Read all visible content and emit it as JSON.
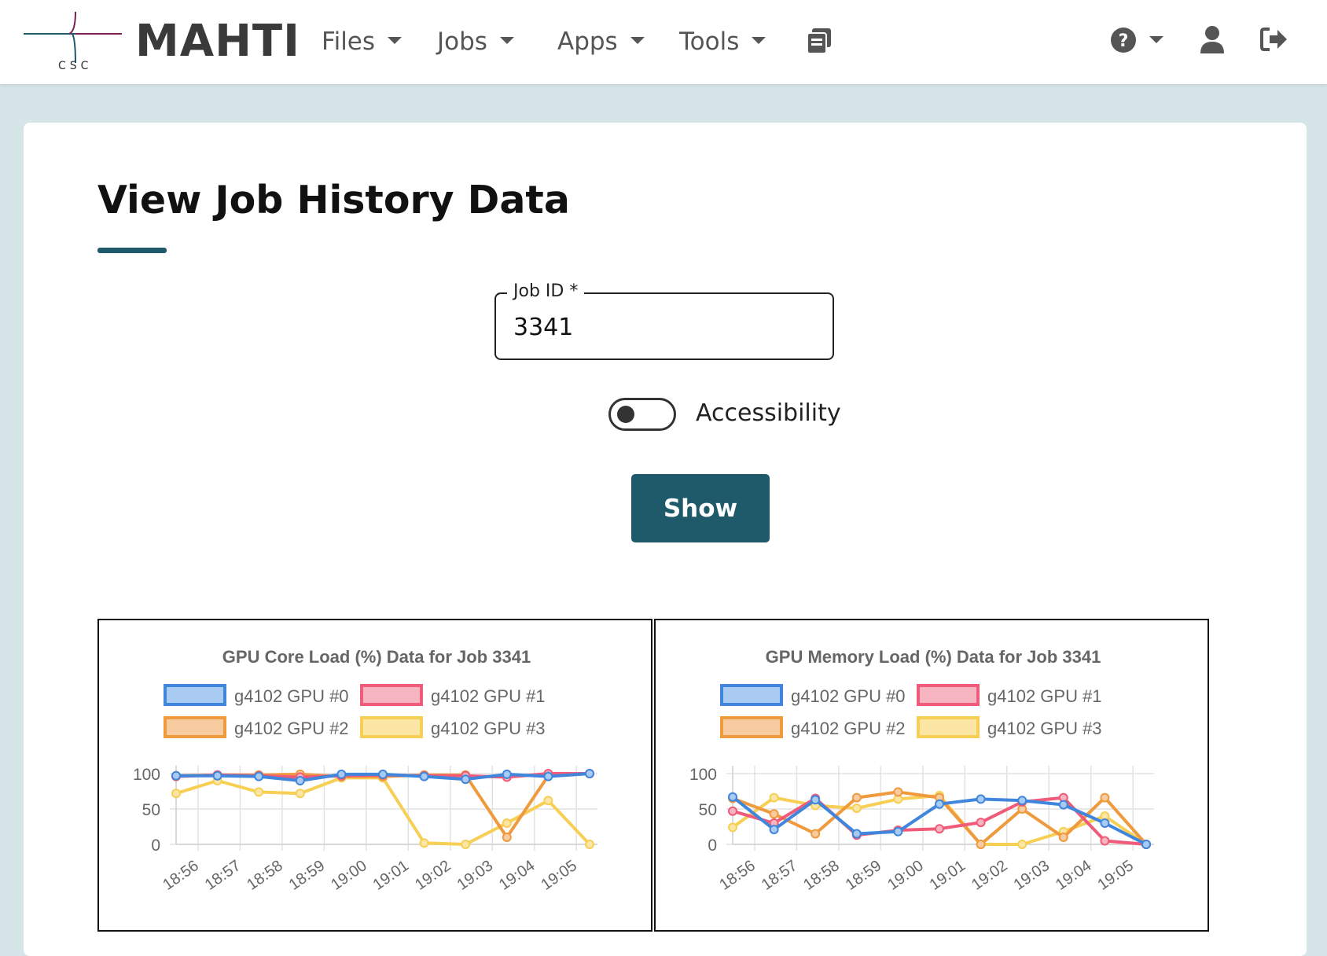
{
  "navbar": {
    "logo_text": "CSC",
    "brand": "MAHTI",
    "items": [
      {
        "label": "Files"
      },
      {
        "label": "Jobs"
      },
      {
        "label": "Apps"
      },
      {
        "label": "Tools"
      }
    ],
    "icons": [
      "clipboard-icon",
      "help-icon",
      "user-icon",
      "logout-icon"
    ]
  },
  "page": {
    "title": "View Job History Data"
  },
  "form": {
    "job_id_label": "Job ID *",
    "job_id_value": "3341",
    "accessibility_label": "Accessibility",
    "accessibility_on": false,
    "show_label": "Show"
  },
  "colors": {
    "accent": "#1f5a6b",
    "gpu0": "#3f86dc",
    "gpu1": "#ef5b78",
    "gpu2": "#f09a3e",
    "gpu3": "#f7cf54"
  },
  "chart_data": [
    {
      "type": "line",
      "title": "GPU Core Load (%) Data for Job 3341",
      "xlabel": "",
      "ylabel": "",
      "ylim": [
        0,
        100
      ],
      "yticks": [
        0,
        50,
        100
      ],
      "x": [
        "18:56",
        "18:57",
        "18:58",
        "18:59",
        "19:00",
        "19:01",
        "19:02",
        "19:03",
        "19:04",
        "19:05"
      ],
      "legend": "top",
      "grid": true,
      "series": [
        {
          "name": "g4102 GPU #0",
          "values": [
            97,
            97,
            96,
            90,
            99,
            99,
            96,
            92,
            99,
            96,
            100
          ]
        },
        {
          "name": "g4102 GPU #1",
          "values": [
            96,
            98,
            97,
            95,
            97,
            98,
            97,
            97,
            95,
            100,
            100
          ]
        },
        {
          "name": "g4102 GPU #2",
          "values": [
            97,
            98,
            98,
            99,
            96,
            96,
            98,
            98,
            10,
            97,
            100
          ]
        },
        {
          "name": "g4102 GPU #3",
          "values": [
            72,
            90,
            74,
            72,
            94,
            94,
            2,
            0,
            30,
            62,
            0
          ]
        }
      ]
    },
    {
      "type": "line",
      "title": "GPU Memory Load (%) Data for Job 3341",
      "xlabel": "",
      "ylabel": "",
      "ylim": [
        0,
        100
      ],
      "yticks": [
        0,
        50,
        100
      ],
      "x": [
        "18:56",
        "18:57",
        "18:58",
        "18:59",
        "19:00",
        "19:01",
        "19:02",
        "19:03",
        "19:04",
        "19:05"
      ],
      "legend": "top",
      "grid": true,
      "series": [
        {
          "name": "g4102 GPU #0",
          "values": [
            67,
            21,
            63,
            15,
            18,
            57,
            64,
            62,
            56,
            30,
            0
          ]
        },
        {
          "name": "g4102 GPU #1",
          "values": [
            47,
            30,
            65,
            13,
            20,
            22,
            31,
            60,
            66,
            5,
            0
          ]
        },
        {
          "name": "g4102 GPU #2",
          "values": [
            65,
            43,
            15,
            66,
            74,
            66,
            0,
            50,
            10,
            66,
            0
          ]
        },
        {
          "name": "g4102 GPU #3",
          "values": [
            24,
            66,
            55,
            51,
            64,
            69,
            0,
            0,
            18,
            40,
            0
          ]
        }
      ]
    }
  ]
}
